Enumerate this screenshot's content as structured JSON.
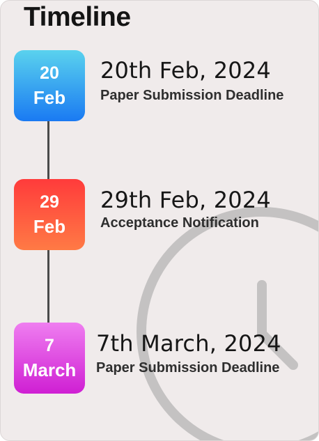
{
  "title": "Timeline",
  "events": [
    {
      "day": "20",
      "month": "Feb",
      "date": "20th Feb, 2024",
      "label": "Paper Submission Deadline"
    },
    {
      "day": "29",
      "month": "Feb",
      "date": "29th Feb, 2024",
      "label": "Acceptance Notification"
    },
    {
      "day": "7",
      "month": "March",
      "date": "7th March, 2024",
      "label": "Paper Submission Deadline"
    }
  ],
  "colors": {
    "background": "#f0ebeb",
    "event_1_box": [
      "#5ad2ee",
      "#1a7af2"
    ],
    "event_2_box": [
      "#ff3b3b",
      "#ff7a45"
    ],
    "event_3_box": [
      "#ef7ef0",
      "#cf1fd3"
    ],
    "watermark": "#c4c2c2"
  },
  "icons": {
    "background": "clock-watermark-icon"
  }
}
